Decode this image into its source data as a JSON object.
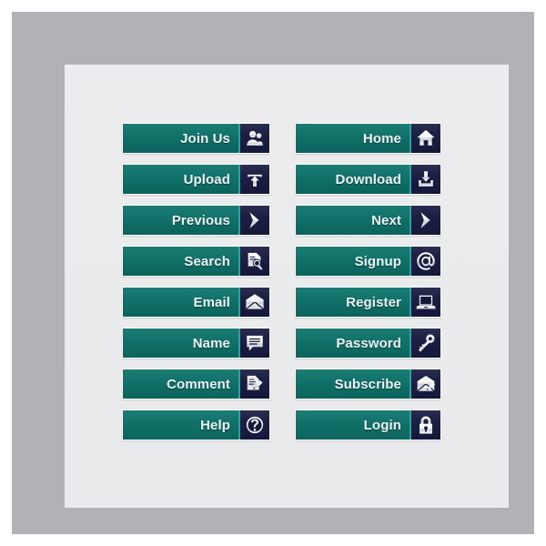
{
  "colors": {
    "background": "#ffffff",
    "frame": "#b0b2b5",
    "panel": "#ebecee",
    "button_teal": "#11736b",
    "button_teal_light": "#1b7d74",
    "button_edge": "#23a79a",
    "icon_box_navy": "#14183a",
    "label_text": "#eef2f3"
  },
  "buttons": {
    "left_column": [
      {
        "label": "Join Us",
        "icon": "users-icon"
      },
      {
        "label": "Upload",
        "icon": "upload-tray-icon"
      },
      {
        "label": "Previous",
        "icon": "arrow-right-chevron-icon"
      },
      {
        "label": "Search",
        "icon": "document-magnifier-icon"
      },
      {
        "label": "Email",
        "icon": "envelope-icon"
      },
      {
        "label": "Name",
        "icon": "speech-bubble-icon"
      },
      {
        "label": "Comment",
        "icon": "document-pen-icon"
      },
      {
        "label": "Help",
        "icon": "question-mark-circle-icon"
      }
    ],
    "right_column": [
      {
        "label": "Home",
        "icon": "house-icon"
      },
      {
        "label": "Download",
        "icon": "download-tray-icon"
      },
      {
        "label": "Next",
        "icon": "arrow-right-chevron-icon"
      },
      {
        "label": "Signup",
        "icon": "at-sign-icon"
      },
      {
        "label": "Register",
        "icon": "laptop-icon"
      },
      {
        "label": "Password",
        "icon": "key-icon"
      },
      {
        "label": "Subscribe",
        "icon": "envelope-pen-icon"
      },
      {
        "label": "Login",
        "icon": "padlock-icon"
      }
    ]
  }
}
